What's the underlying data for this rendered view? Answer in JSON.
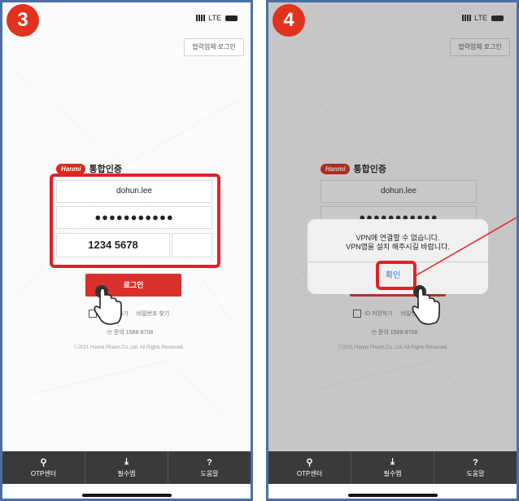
{
  "step1": {
    "badge": "3",
    "status": {
      "network": "LTE"
    },
    "partner_login": "협력업체 로그인",
    "logo": {
      "brand": "Hanmi",
      "title": "통합인증"
    },
    "id_value": "dohun.lee",
    "password_mask": "●●●●●●●●●●●",
    "otp_value": "1234 5678",
    "login_button": "로그인",
    "save_id_label": "ID 저장하기",
    "find_password": "비밀번호 찾기",
    "inquiry": "☏ 문의 1588-9708",
    "copyright": "ⓒ2021 Hanmi Pharm.Co.,Ltd. All Rights Reserved.",
    "nav": [
      {
        "icon": "⚲",
        "label": "OTP센터"
      },
      {
        "icon": "⤓",
        "label": "필수앱"
      },
      {
        "icon": "?",
        "label": "도움말"
      }
    ]
  },
  "step2": {
    "badge": "4",
    "status": {
      "network": "LTE"
    },
    "partner_login": "협력업체 로그인",
    "logo": {
      "brand": "Hanmi",
      "title": "통합인증"
    },
    "id_value": "dohun.lee",
    "password_mask": "●●●●●●●●●●●",
    "save_id_label": "ID 저장하기",
    "find_password": "비밀번호 찾기",
    "inquiry": "☏ 문의 1588-9708",
    "copyright": "ⓒ2021 Hanmi Pharm.Co.,Ltd. All Rights Reserved.",
    "dialog": {
      "line1": "VPN에 연결할 수 없습니다.",
      "line2": "VPN앱을 설치 해주시길 바랍니다.",
      "confirm": "확인"
    },
    "nav": [
      {
        "icon": "⚲",
        "label": "OTP센터"
      },
      {
        "icon": "⤓",
        "label": "필수앱"
      },
      {
        "icon": "?",
        "label": "도움말"
      }
    ]
  },
  "colors": {
    "accent_red": "#e2311d",
    "frame_blue": "#4a6fa5",
    "dialog_blue": "#3577d8"
  }
}
